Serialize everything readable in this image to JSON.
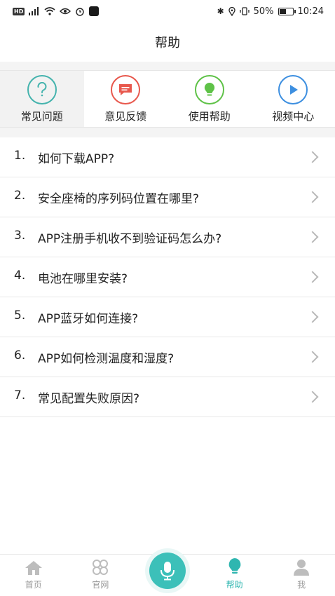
{
  "status_bar": {
    "hd": "HD",
    "battery_percent_text": "50%",
    "battery_level": 0.5,
    "time": "10:24"
  },
  "header": {
    "title": "帮助"
  },
  "categories": [
    {
      "label": "常见问题",
      "icon": "question-icon",
      "color": "#44b3ad",
      "active": true
    },
    {
      "label": "意见反馈",
      "icon": "feedback-icon",
      "color": "#e8584d",
      "active": false
    },
    {
      "label": "使用帮助",
      "icon": "lightbulb-icon",
      "color": "#5fc248",
      "active": false
    },
    {
      "label": "视频中心",
      "icon": "play-icon",
      "color": "#3d8fe0",
      "active": false
    }
  ],
  "faq": [
    {
      "num": "1.",
      "text": "如何下载APP?"
    },
    {
      "num": "2.",
      "text": "安全座椅的序列码位置在哪里?"
    },
    {
      "num": "3.",
      "text": "APP注册手机收不到验证码怎么办?"
    },
    {
      "num": "4.",
      "text": "电池在哪里安装?"
    },
    {
      "num": "5.",
      "text": "APP蓝牙如何连接?"
    },
    {
      "num": "6.",
      "text": "APP如何检测温度和湿度?"
    },
    {
      "num": "7.",
      "text": "常见配置失败原因?"
    }
  ],
  "bottom_nav": {
    "home": "首页",
    "official": "官网",
    "help": "帮助",
    "me": "我",
    "active_color": "#2fb6b0",
    "inactive_color": "#bdbdbd"
  }
}
